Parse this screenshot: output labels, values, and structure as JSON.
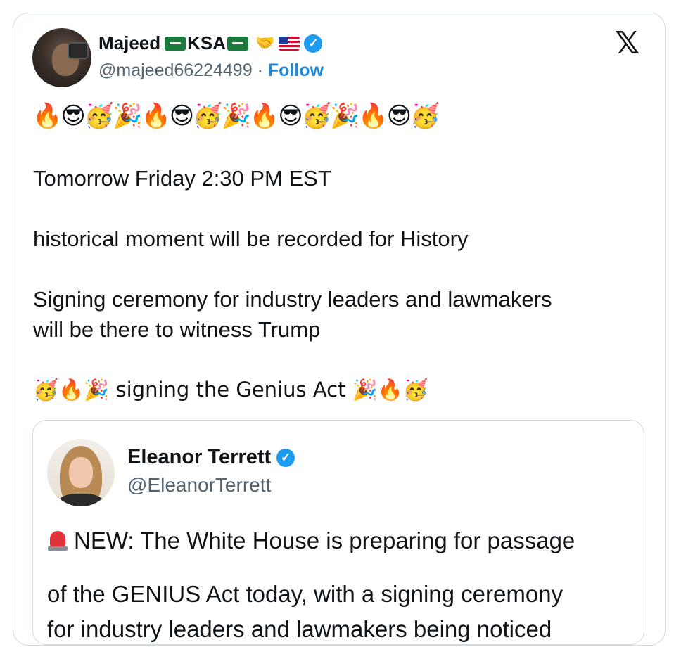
{
  "tweet": {
    "display_name": "Majeed",
    "name_suffix": "KSA",
    "handle": "@majeed66224499",
    "separator": "·",
    "follow_label": "Follow",
    "emoji_header": "🔥😎🥳🎉🔥😎🥳🎉🔥😎🥳🎉🔥😎🥳",
    "lines": [
      "Tomorrow Friday 2:30 PM EST",
      "historical moment will be recorded for History",
      "Signing ceremony for industry leaders and lawmakers",
      "will be there to witness Trump",
      "🥳🔥🎉 signing the Genius Act 🎉🔥🥳"
    ]
  },
  "quoted_tweet": {
    "display_name": "Eleanor Terrett",
    "handle": "@EleanorTerrett",
    "lines": [
      "NEW: The White House is preparing for passage",
      "of the GENIUS Act today, with a signing ceremony",
      "for industry leaders and lawmakers being noticed"
    ]
  },
  "icons": {
    "verified": "verified-badge-icon",
    "x_logo": "x-logo-icon",
    "siren": "siren-icon"
  },
  "colors": {
    "follow": "#1d8ae0",
    "verified": "#1d9bf0",
    "border": "#cfd9de",
    "secondary_text": "#536471"
  }
}
